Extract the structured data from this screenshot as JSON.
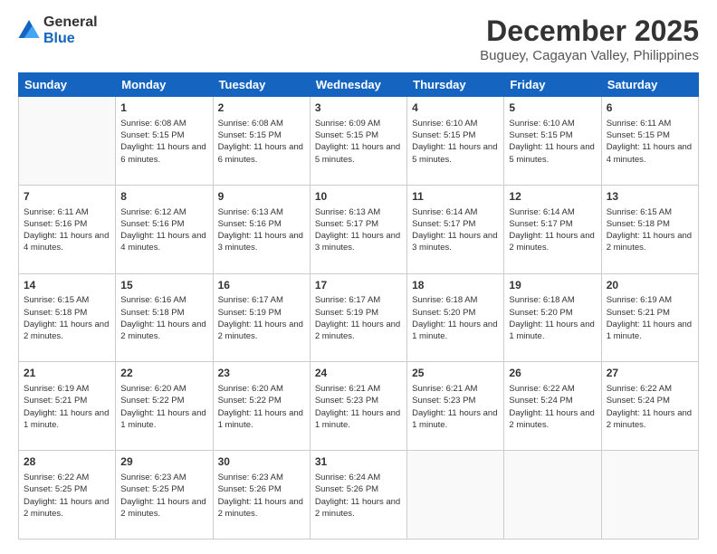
{
  "logo": {
    "general": "General",
    "blue": "Blue"
  },
  "title": "December 2025",
  "subtitle": "Buguey, Cagayan Valley, Philippines",
  "days": [
    "Sunday",
    "Monday",
    "Tuesday",
    "Wednesday",
    "Thursday",
    "Friday",
    "Saturday"
  ],
  "weeks": [
    [
      {
        "day": "",
        "info": ""
      },
      {
        "day": "1",
        "info": "Sunrise: 6:08 AM\nSunset: 5:15 PM\nDaylight: 11 hours and 6 minutes."
      },
      {
        "day": "2",
        "info": "Sunrise: 6:08 AM\nSunset: 5:15 PM\nDaylight: 11 hours and 6 minutes."
      },
      {
        "day": "3",
        "info": "Sunrise: 6:09 AM\nSunset: 5:15 PM\nDaylight: 11 hours and 5 minutes."
      },
      {
        "day": "4",
        "info": "Sunrise: 6:10 AM\nSunset: 5:15 PM\nDaylight: 11 hours and 5 minutes."
      },
      {
        "day": "5",
        "info": "Sunrise: 6:10 AM\nSunset: 5:15 PM\nDaylight: 11 hours and 5 minutes."
      },
      {
        "day": "6",
        "info": "Sunrise: 6:11 AM\nSunset: 5:15 PM\nDaylight: 11 hours and 4 minutes."
      }
    ],
    [
      {
        "day": "7",
        "info": "Sunrise: 6:11 AM\nSunset: 5:16 PM\nDaylight: 11 hours and 4 minutes."
      },
      {
        "day": "8",
        "info": "Sunrise: 6:12 AM\nSunset: 5:16 PM\nDaylight: 11 hours and 4 minutes."
      },
      {
        "day": "9",
        "info": "Sunrise: 6:13 AM\nSunset: 5:16 PM\nDaylight: 11 hours and 3 minutes."
      },
      {
        "day": "10",
        "info": "Sunrise: 6:13 AM\nSunset: 5:17 PM\nDaylight: 11 hours and 3 minutes."
      },
      {
        "day": "11",
        "info": "Sunrise: 6:14 AM\nSunset: 5:17 PM\nDaylight: 11 hours and 3 minutes."
      },
      {
        "day": "12",
        "info": "Sunrise: 6:14 AM\nSunset: 5:17 PM\nDaylight: 11 hours and 2 minutes."
      },
      {
        "day": "13",
        "info": "Sunrise: 6:15 AM\nSunset: 5:18 PM\nDaylight: 11 hours and 2 minutes."
      }
    ],
    [
      {
        "day": "14",
        "info": "Sunrise: 6:15 AM\nSunset: 5:18 PM\nDaylight: 11 hours and 2 minutes."
      },
      {
        "day": "15",
        "info": "Sunrise: 6:16 AM\nSunset: 5:18 PM\nDaylight: 11 hours and 2 minutes."
      },
      {
        "day": "16",
        "info": "Sunrise: 6:17 AM\nSunset: 5:19 PM\nDaylight: 11 hours and 2 minutes."
      },
      {
        "day": "17",
        "info": "Sunrise: 6:17 AM\nSunset: 5:19 PM\nDaylight: 11 hours and 2 minutes."
      },
      {
        "day": "18",
        "info": "Sunrise: 6:18 AM\nSunset: 5:20 PM\nDaylight: 11 hours and 1 minute."
      },
      {
        "day": "19",
        "info": "Sunrise: 6:18 AM\nSunset: 5:20 PM\nDaylight: 11 hours and 1 minute."
      },
      {
        "day": "20",
        "info": "Sunrise: 6:19 AM\nSunset: 5:21 PM\nDaylight: 11 hours and 1 minute."
      }
    ],
    [
      {
        "day": "21",
        "info": "Sunrise: 6:19 AM\nSunset: 5:21 PM\nDaylight: 11 hours and 1 minute."
      },
      {
        "day": "22",
        "info": "Sunrise: 6:20 AM\nSunset: 5:22 PM\nDaylight: 11 hours and 1 minute."
      },
      {
        "day": "23",
        "info": "Sunrise: 6:20 AM\nSunset: 5:22 PM\nDaylight: 11 hours and 1 minute."
      },
      {
        "day": "24",
        "info": "Sunrise: 6:21 AM\nSunset: 5:23 PM\nDaylight: 11 hours and 1 minute."
      },
      {
        "day": "25",
        "info": "Sunrise: 6:21 AM\nSunset: 5:23 PM\nDaylight: 11 hours and 1 minute."
      },
      {
        "day": "26",
        "info": "Sunrise: 6:22 AM\nSunset: 5:24 PM\nDaylight: 11 hours and 2 minutes."
      },
      {
        "day": "27",
        "info": "Sunrise: 6:22 AM\nSunset: 5:24 PM\nDaylight: 11 hours and 2 minutes."
      }
    ],
    [
      {
        "day": "28",
        "info": "Sunrise: 6:22 AM\nSunset: 5:25 PM\nDaylight: 11 hours and 2 minutes."
      },
      {
        "day": "29",
        "info": "Sunrise: 6:23 AM\nSunset: 5:25 PM\nDaylight: 11 hours and 2 minutes."
      },
      {
        "day": "30",
        "info": "Sunrise: 6:23 AM\nSunset: 5:26 PM\nDaylight: 11 hours and 2 minutes."
      },
      {
        "day": "31",
        "info": "Sunrise: 6:24 AM\nSunset: 5:26 PM\nDaylight: 11 hours and 2 minutes."
      },
      {
        "day": "",
        "info": ""
      },
      {
        "day": "",
        "info": ""
      },
      {
        "day": "",
        "info": ""
      }
    ]
  ]
}
